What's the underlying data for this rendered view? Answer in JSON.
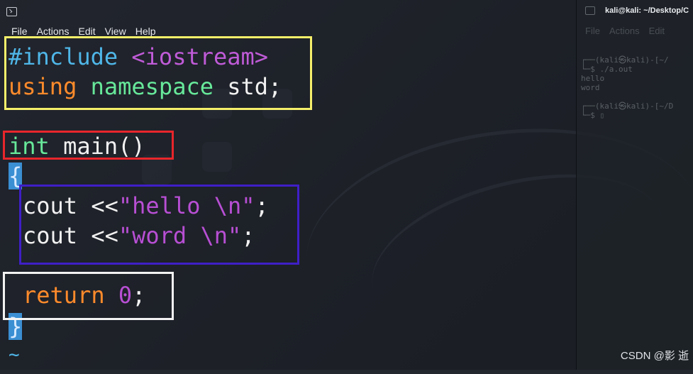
{
  "terminal": {
    "title": "",
    "menu": [
      "File",
      "Actions",
      "Edit",
      "View",
      "Help"
    ]
  },
  "code": {
    "line1": {
      "directive": "#include",
      "header": "<iostream>"
    },
    "line2": {
      "kw": "using",
      "ns": "namespace",
      "rest": "std;"
    },
    "line3": {
      "type": "int",
      "rest": "main()"
    },
    "line4": "{",
    "line5": {
      "pre": "cout <<",
      "str": "\"hello \\n\"",
      "end": ";"
    },
    "line6": {
      "pre": "cout <<",
      "str": "\"word \\n\"",
      "end": ";"
    },
    "line7": {
      "kw": "return",
      "num": "0",
      "end": ";"
    },
    "line8": "}",
    "line9": "~"
  },
  "highlight_colors": {
    "include_box": "#f5ef6a",
    "main_box": "#e8262b",
    "cout_box": "#3f1fc7",
    "return_box": "#f2f2f2"
  },
  "terminal2": {
    "title": "kali@kali: ~/Desktop/C",
    "menu": [
      "File",
      "Actions",
      "Edit"
    ],
    "output": "┌──(kali㉿kali)-[~/\n└─$ ./a.out\nhello\nword\n\n┌──(kali㉿kali)-[~/D\n└─$ ▯"
  },
  "watermark": "CSDN @影 逝"
}
